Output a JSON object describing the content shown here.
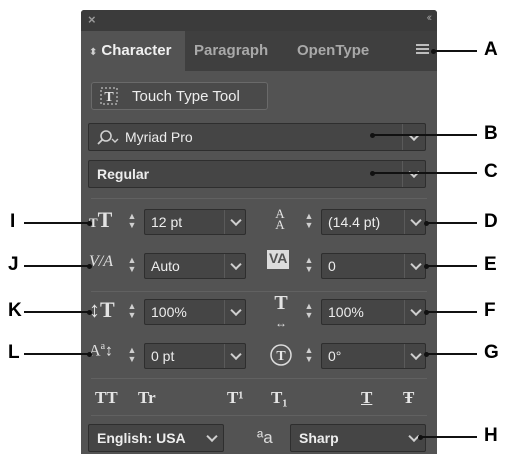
{
  "window": {
    "close_glyph": "×",
    "collapse_glyph": "‹‹"
  },
  "tabs": [
    {
      "label": "Character",
      "active": true
    },
    {
      "label": "Paragraph",
      "active": false
    },
    {
      "label": "OpenType",
      "active": false
    }
  ],
  "toolbar": {
    "touch_type_label": "Touch Type Tool"
  },
  "font": {
    "family": "Myriad Pro",
    "style": "Regular"
  },
  "metrics": {
    "font_size": "12 pt",
    "leading": "(14.4 pt)",
    "kerning": "Auto",
    "tracking": "0",
    "vertical_scale": "100%",
    "horizontal_scale": "100%",
    "baseline_shift": "0 pt",
    "rotation": "0°"
  },
  "type_styles": [
    "TT",
    "Tr",
    "T¹",
    "T₁",
    "T",
    "Ŧ"
  ],
  "bottom": {
    "language": "English: USA",
    "aa_method": "Sharp",
    "aa_glyph": "ªa"
  },
  "callouts": {
    "A": "A",
    "B": "B",
    "C": "C",
    "D": "D",
    "E": "E",
    "F": "F",
    "G": "G",
    "H": "H",
    "I": "I",
    "J": "J",
    "K": "K",
    "L": "L"
  },
  "colors": {
    "panel": "#535353",
    "tabbar": "#3f3f3f",
    "field": "#454545"
  }
}
